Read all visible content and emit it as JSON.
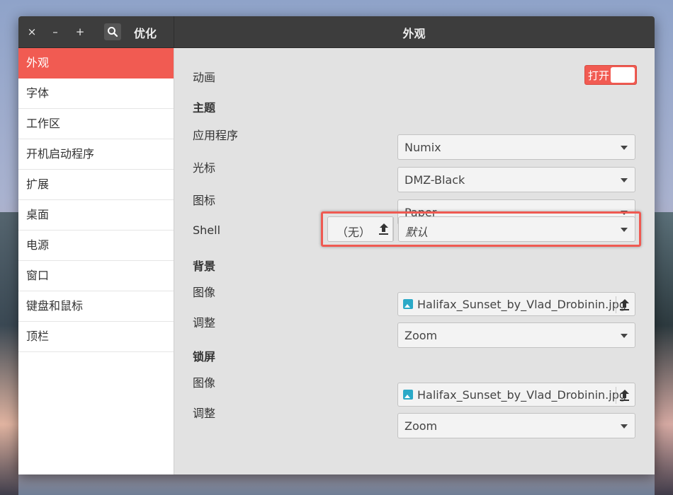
{
  "window": {
    "app_title": "优化",
    "page_title": "外观",
    "controls": {
      "close": "×",
      "minimize": "–",
      "maximize": "+"
    }
  },
  "sidebar": {
    "items": [
      {
        "label": "外观",
        "active": true
      },
      {
        "label": "字体"
      },
      {
        "label": "工作区"
      },
      {
        "label": "开机启动程序"
      },
      {
        "label": "扩展"
      },
      {
        "label": "桌面"
      },
      {
        "label": "电源"
      },
      {
        "label": "窗口"
      },
      {
        "label": "键盘和鼠标"
      },
      {
        "label": "顶栏"
      }
    ]
  },
  "content": {
    "animation": {
      "label": "动画",
      "toggle_label": "打开",
      "on": true
    },
    "theme": {
      "title": "主题",
      "application": {
        "label": "应用程序",
        "value": "Numix"
      },
      "cursor": {
        "label": "光标",
        "value": "DMZ-Black"
      },
      "icons": {
        "label": "图标",
        "value": "Paper"
      },
      "shell": {
        "label": "Shell",
        "none_label": "（无）",
        "value": "默认"
      }
    },
    "background": {
      "title": "背景",
      "image": {
        "label": "图像",
        "file": "Halifax_Sunset_by_Vlad_Drobinin.jpg"
      },
      "adjust": {
        "label": "调整",
        "value": "Zoom"
      }
    },
    "lockscreen": {
      "title": "锁屏",
      "image": {
        "label": "图像",
        "file": "Halifax_Sunset_by_Vlad_Drobinin.jpg"
      },
      "adjust": {
        "label": "调整",
        "value": "Zoom"
      }
    }
  },
  "colors": {
    "accent": "#f15b52",
    "titlebar": "#3d3d3d",
    "file_icon": "#2aa9c7"
  },
  "icons": [
    "close-icon",
    "minimize-icon",
    "maximize-icon",
    "search-icon",
    "dropdown-arrow-icon",
    "upload-icon",
    "image-file-icon"
  ]
}
